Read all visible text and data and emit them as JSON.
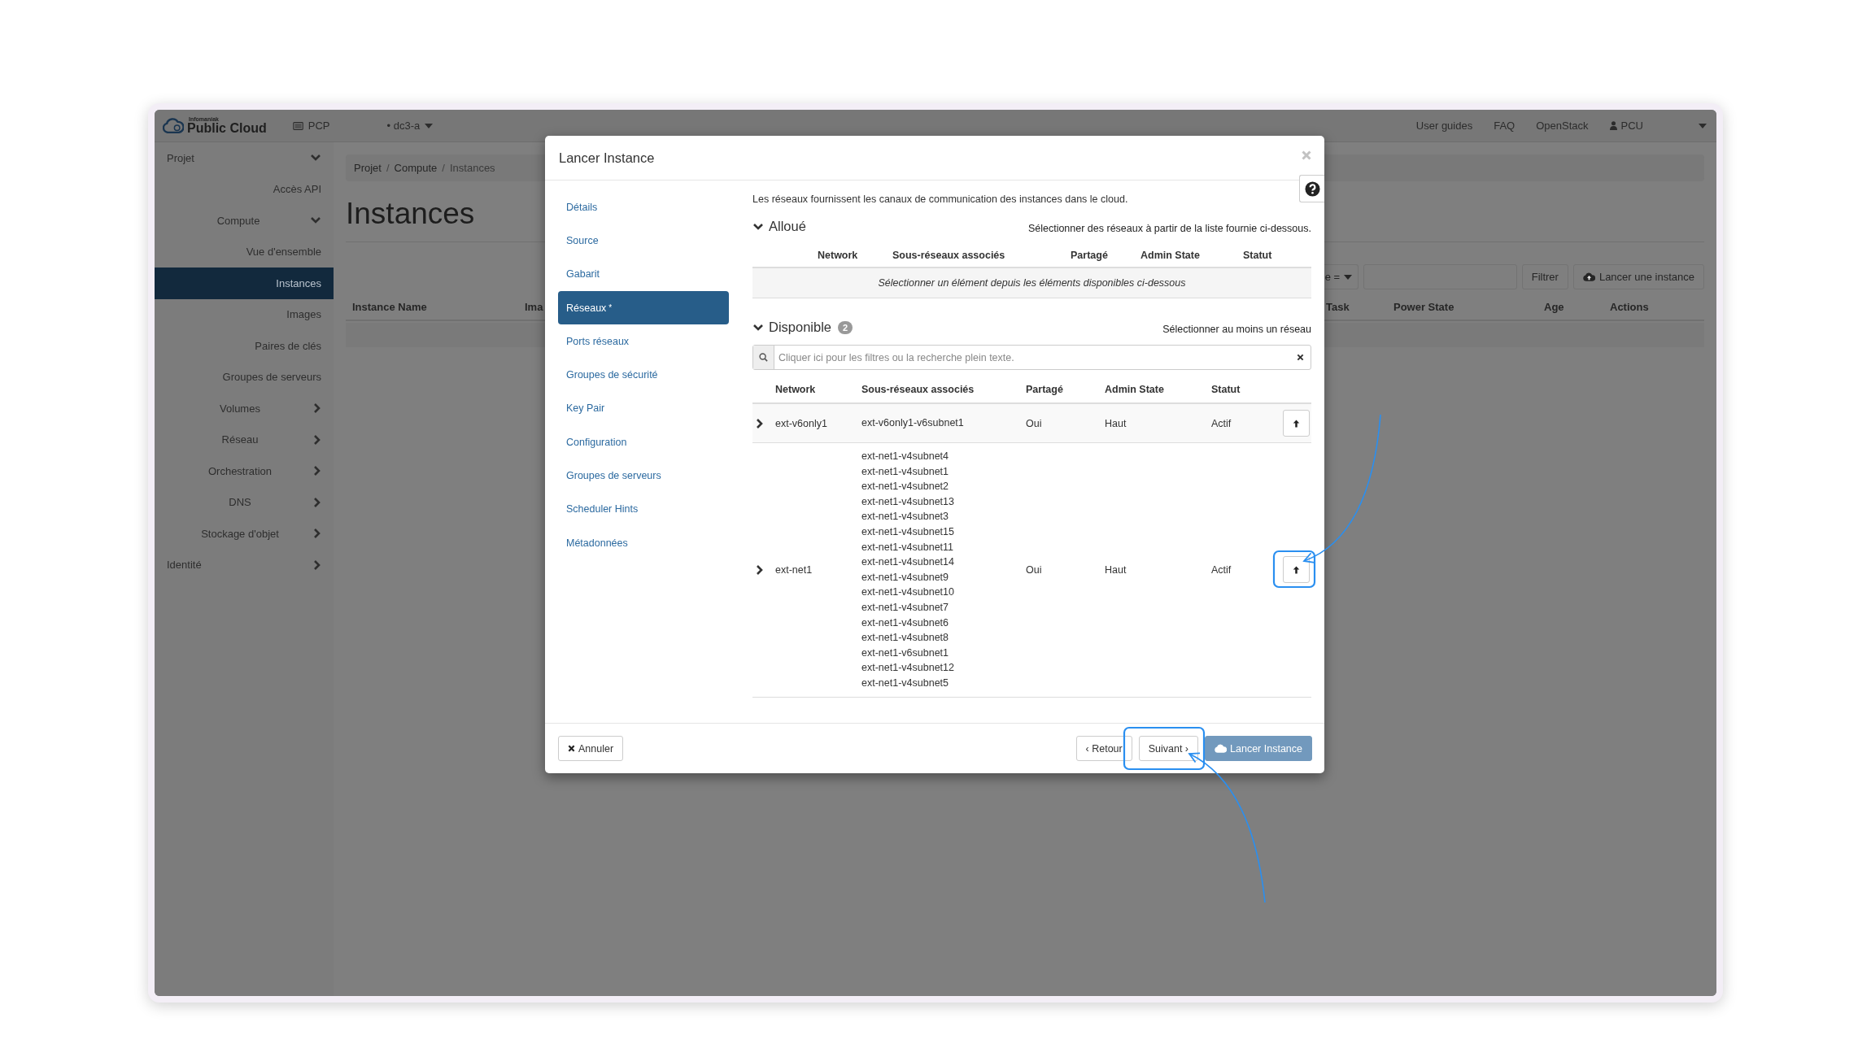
{
  "topbar": {
    "brand_label": "Infomaniak",
    "brand": "Public Cloud",
    "project": "PCP",
    "region": "• dc3-a",
    "links": [
      "User guides",
      "FAQ",
      "OpenStack"
    ],
    "user": "PCU"
  },
  "sidebar": {
    "items": [
      {
        "label": "Projet",
        "expanded": true,
        "children": [
          {
            "label": "Accès API",
            "selected": false
          },
          {
            "label": "Compute",
            "expanded": true,
            "children": [
              {
                "label": "Vue d'ensemble",
                "selected": false
              },
              {
                "label": "Instances",
                "selected": true
              },
              {
                "label": "Images",
                "selected": false
              },
              {
                "label": "Paires de clés",
                "selected": false
              },
              {
                "label": "Groupes de serveurs",
                "selected": false
              }
            ]
          },
          {
            "label": "Volumes",
            "expanded": false
          },
          {
            "label": "Réseau",
            "expanded": false
          },
          {
            "label": "Orchestration",
            "expanded": false
          },
          {
            "label": "DNS",
            "expanded": false
          },
          {
            "label": "Stockage d'objet",
            "expanded": false
          }
        ]
      },
      {
        "label": "Identité",
        "expanded": false
      }
    ]
  },
  "page": {
    "breadcrumb": {
      "items": [
        "Projet",
        "Compute",
        "Instances"
      ],
      "separator": "/"
    },
    "title": "Instances",
    "toolbar": {
      "filter_field": "e =",
      "filter_button": "Filtrer",
      "launch_button": "Lancer une instance"
    },
    "table": {
      "columns": [
        "Instance Name",
        "Ima",
        "Task",
        "Power State",
        "Age",
        "Actions"
      ]
    }
  },
  "modal": {
    "title": "Lancer Instance",
    "steps": [
      {
        "label": "Détails",
        "selected": false
      },
      {
        "label": "Source",
        "selected": false
      },
      {
        "label": "Gabarit",
        "selected": false
      },
      {
        "label": "Réseaux",
        "marker": "*",
        "selected": true
      },
      {
        "label": "Ports réseaux",
        "selected": false
      },
      {
        "label": "Groupes de sécurité",
        "selected": false
      },
      {
        "label": "Key Pair",
        "selected": false
      },
      {
        "label": "Configuration",
        "selected": false
      },
      {
        "label": "Groupes de serveurs",
        "selected": false
      },
      {
        "label": "Scheduler Hints",
        "selected": false
      },
      {
        "label": "Métadonnées",
        "selected": false
      }
    ],
    "intro": "Les réseaux fournissent les canaux de communication des instances dans le cloud.",
    "allocated": {
      "title": "Alloué",
      "expanded": true,
      "hint": "Sélectionner des réseaux à partir de la liste fournie ci-dessous.",
      "columns": [
        "Network",
        "Sous-réseaux associés",
        "Partagé",
        "Admin State",
        "Statut"
      ],
      "empty_message": "Sélectionner un élément depuis les éléments disponibles ci-dessous"
    },
    "available": {
      "title": "Disponible",
      "expanded": true,
      "count": "2",
      "hint": "Sélectionner au moins un réseau",
      "search": {
        "placeholder": "Cliquer ici pour les filtres ou la recherche plein texte."
      },
      "columns": [
        "Network",
        "Sous-réseaux associés",
        "Partagé",
        "Admin State",
        "Statut"
      ],
      "rows": [
        {
          "network": "ext-v6only1",
          "expanded": false,
          "subnets": [
            "ext-v6only1-v6subnet1"
          ],
          "shared": "Oui",
          "admin_state": "Haut",
          "status": "Actif"
        },
        {
          "network": "ext-net1",
          "expanded": false,
          "subnets": [
            "ext-net1-v4subnet4",
            "ext-net1-v4subnet1",
            "ext-net1-v4subnet2",
            "ext-net1-v4subnet13",
            "ext-net1-v4subnet3",
            "ext-net1-v4subnet15",
            "ext-net1-v4subnet11",
            "ext-net1-v4subnet14",
            "ext-net1-v4subnet9",
            "ext-net1-v4subnet10",
            "ext-net1-v4subnet7",
            "ext-net1-v4subnet6",
            "ext-net1-v4subnet8",
            "ext-net1-v6subnet1",
            "ext-net1-v4subnet12",
            "ext-net1-v4subnet5"
          ],
          "shared": "Oui",
          "admin_state": "Haut",
          "status": "Actif"
        }
      ]
    },
    "footer": {
      "cancel": "Annuler",
      "back": "‹ Retour",
      "next": "Suivant ›",
      "launch": {
        "label": "Lancer Instance",
        "disabled": true
      }
    }
  }
}
